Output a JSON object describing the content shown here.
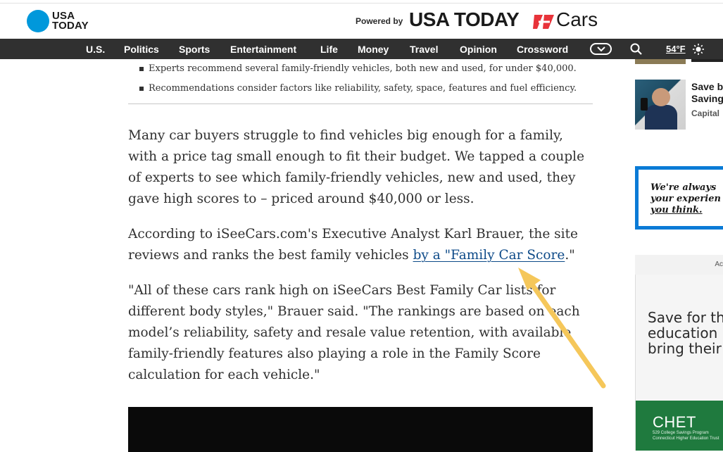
{
  "header": {
    "logo_line1": "USA",
    "logo_line2": "TODAY",
    "powered_by": "Powered by",
    "brand_usa": "USA TODAY",
    "brand_cars": "Cars"
  },
  "nav": {
    "items": [
      "U.S.",
      "Politics",
      "Sports",
      "Entertainment",
      "Life",
      "Money",
      "Travel",
      "Opinion",
      "Crossword"
    ],
    "temperature": "54°F",
    "more_icon": "chevron-down-icon",
    "search_icon": "search-icon",
    "weather_icon": "sun-icon"
  },
  "article": {
    "bullets": [
      "Experts recommend several family-friendly vehicles, both new and used, for under $40,000.",
      "Recommendations consider factors like reliability, safety, space, features and fuel efficiency."
    ],
    "para1": "Many car buyers struggle to find vehicles big enough for a family, with a price tag small enough to fit their budget. We tapped a couple of experts to see which family-friendly vehicles, new and used, they gave high scores to – priced around $40,000 or less.",
    "para2_before": "According to iSeeCars.com's Executive Analyst Karl Brauer, the site reviews and ranks the best family vehicles ",
    "para2_link": "by a \"Family Car Score",
    "para2_after": ".\"",
    "para3": "\"All of these cars rank high on iSeeCars Best Family Car lists for different body styles,\" Brauer said. \"The rankings are based on each model’s reliability, safety and resale value retention, with available family-friendly features also playing a role in the Family Score calculation for each vehicle.\""
  },
  "sidebar": {
    "promo_title": "Save b\nSaving",
    "promo_source": "Capital",
    "feedback_line1": "We're always",
    "feedback_line2": "your experien",
    "feedback_link": "you think.",
    "ad_label": "Ac",
    "ad_headline": "Save for th\neducation\nbring their",
    "ad_brand": "CHET",
    "ad_brand_sub": "529 College Savings Program\nConnecticut Higher Education Trust"
  },
  "colors": {
    "nav_bg": "#303030",
    "brand_blue": "#0098db",
    "link": "#0d4a88",
    "annotation_arrow": "#f5c75a",
    "feedback_border": "#0a7bd6",
    "ad_green": "#1f7a3e"
  }
}
